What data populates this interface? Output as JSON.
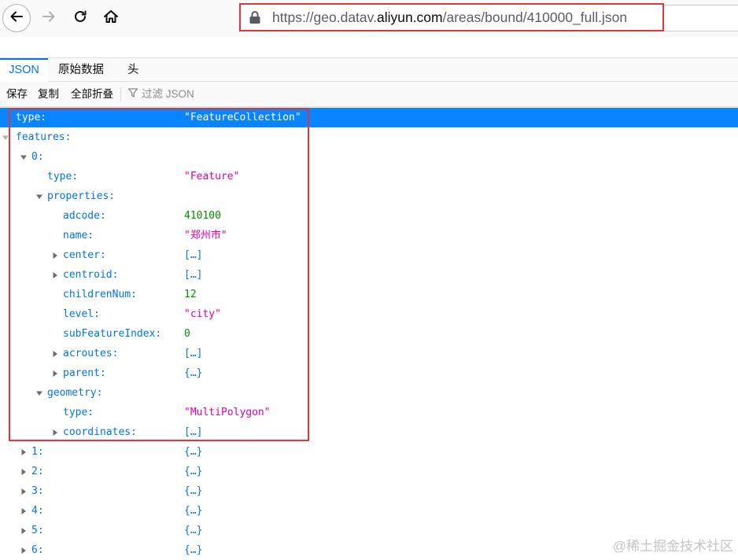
{
  "browser": {
    "url_prefix": "https://geo.datav.",
    "url_host": "aliyun.com",
    "url_suffix": "/areas/bound/410000_full.json"
  },
  "tabs": [
    {
      "label": "JSON",
      "active": true
    },
    {
      "label": "原始数据",
      "active": false
    },
    {
      "label": "头",
      "active": false
    }
  ],
  "actions": {
    "save": "保存",
    "copy": "复制",
    "collapse_all": "全部折叠",
    "filter_placeholder": "过滤 JSON"
  },
  "tree": [
    {
      "key": "type:",
      "value": "\"FeatureCollection\"",
      "kind": "str",
      "depth": 0,
      "twisty": "none",
      "selected": true
    },
    {
      "key": "features:",
      "value": "",
      "kind": "none",
      "depth": 0,
      "twisty": "open"
    },
    {
      "key": "0:",
      "value": "",
      "kind": "none",
      "depth": 1,
      "twisty": "open"
    },
    {
      "key": "type:",
      "value": "\"Feature\"",
      "kind": "str",
      "depth": 2,
      "twisty": "none"
    },
    {
      "key": "properties:",
      "value": "",
      "kind": "none",
      "depth": 2,
      "twisty": "open"
    },
    {
      "key": "adcode:",
      "value": "410100",
      "kind": "num",
      "depth": 3,
      "twisty": "none"
    },
    {
      "key": "name:",
      "value": "\"郑州市\"",
      "kind": "str",
      "depth": 3,
      "twisty": "none"
    },
    {
      "key": "center:",
      "value": "[…]",
      "kind": "obj",
      "depth": 3,
      "twisty": "closed"
    },
    {
      "key": "centroid:",
      "value": "[…]",
      "kind": "obj",
      "depth": 3,
      "twisty": "closed"
    },
    {
      "key": "childrenNum:",
      "value": "12",
      "kind": "num",
      "depth": 3,
      "twisty": "none"
    },
    {
      "key": "level:",
      "value": "\"city\"",
      "kind": "str",
      "depth": 3,
      "twisty": "none"
    },
    {
      "key": "subFeatureIndex:",
      "value": "0",
      "kind": "num",
      "depth": 3,
      "twisty": "none"
    },
    {
      "key": "acroutes:",
      "value": "[…]",
      "kind": "obj",
      "depth": 3,
      "twisty": "closed"
    },
    {
      "key": "parent:",
      "value": "{…}",
      "kind": "obj",
      "depth": 3,
      "twisty": "closed"
    },
    {
      "key": "geometry:",
      "value": "",
      "kind": "none",
      "depth": 2,
      "twisty": "open"
    },
    {
      "key": "type:",
      "value": "\"MultiPolygon\"",
      "kind": "str",
      "depth": 3,
      "twisty": "none"
    },
    {
      "key": "coordinates:",
      "value": "[…]",
      "kind": "obj",
      "depth": 3,
      "twisty": "closed"
    },
    {
      "key": "1:",
      "value": "{…}",
      "kind": "obj",
      "depth": 1,
      "twisty": "closed"
    },
    {
      "key": "2:",
      "value": "{…}",
      "kind": "obj",
      "depth": 1,
      "twisty": "closed"
    },
    {
      "key": "3:",
      "value": "{…}",
      "kind": "obj",
      "depth": 1,
      "twisty": "closed"
    },
    {
      "key": "4:",
      "value": "{…}",
      "kind": "obj",
      "depth": 1,
      "twisty": "closed"
    },
    {
      "key": "5:",
      "value": "{…}",
      "kind": "obj",
      "depth": 1,
      "twisty": "closed"
    },
    {
      "key": "6:",
      "value": "{…}",
      "kind": "obj",
      "depth": 1,
      "twisty": "closed"
    }
  ],
  "watermark": "@稀土掘金技术社区",
  "colors": {
    "accent": "#0a84ff",
    "key": "#0074e8",
    "string": "#dd00a9",
    "number": "#058b00",
    "annotation": "#e0353a"
  }
}
